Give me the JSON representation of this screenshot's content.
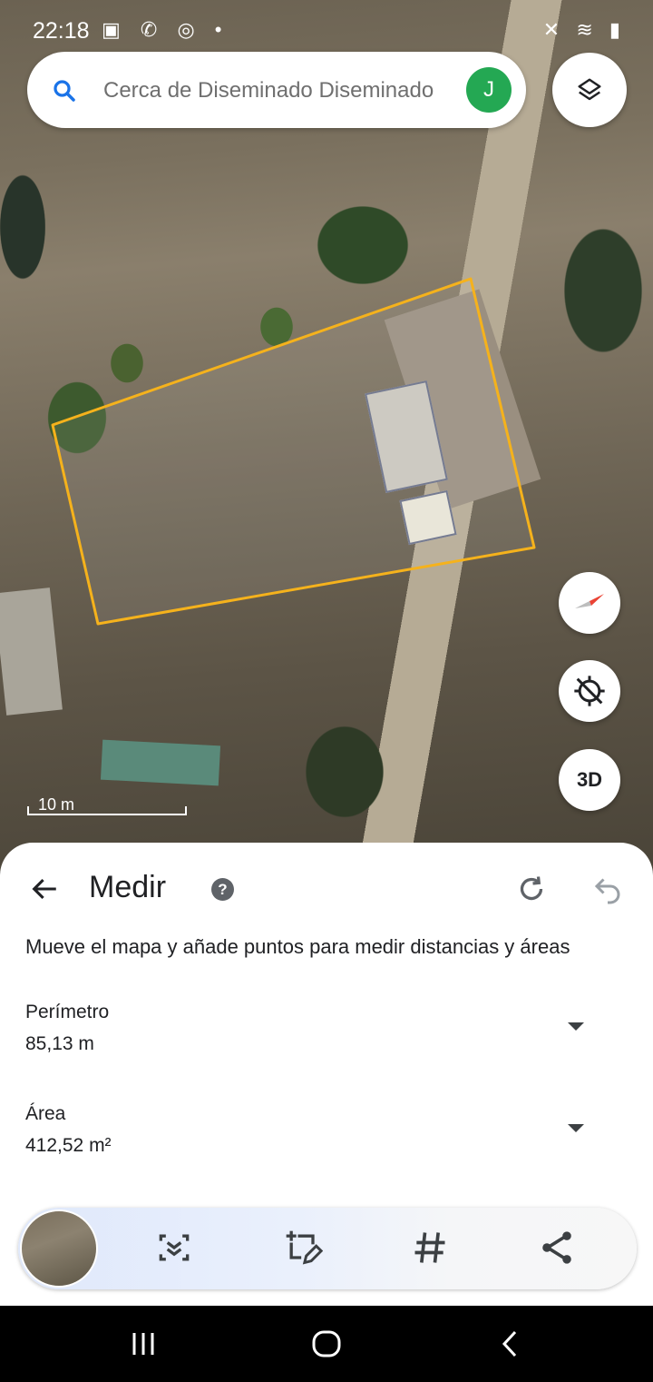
{
  "status_bar": {
    "time": "22:18",
    "left_icons": "▣ ✆ ◎ •",
    "right_icons": "✕ ≋ ▮"
  },
  "search": {
    "placeholder": "Cerca de Diseminado Diseminado",
    "avatar_letter": "J"
  },
  "map": {
    "scale_label": "10 m",
    "compass_icon": "compass-icon",
    "location_icon": "location-off-icon",
    "three_d_label": "3D",
    "layers_icon": "layers-icon",
    "parcel_color": "#f5b21c"
  },
  "measure": {
    "title": "Medir",
    "instructions": "Mueve el mapa y añade puntos para medir distancias y áreas",
    "perimeter_label": "Perímetro",
    "perimeter_value": "85,13 m",
    "area_label": "Área",
    "area_value": "412,52 m²"
  },
  "toolbar": {
    "items": [
      "screenshot-icon",
      "add-place-icon",
      "hashtag-icon",
      "share-icon"
    ]
  },
  "nav": {
    "recent": "|||",
    "home": "○",
    "back": "<"
  },
  "colors": {
    "accent_blue": "#1a73e8",
    "avatar_green": "#24a853",
    "compass_red": "#ea4335"
  }
}
